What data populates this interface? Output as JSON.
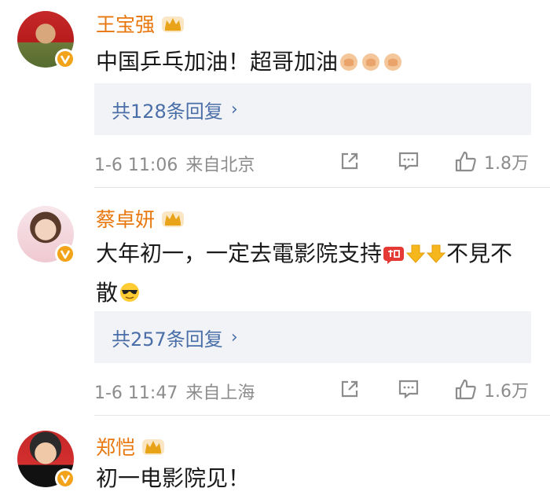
{
  "comments": [
    {
      "username": "王宝强",
      "text": "中国乒乓加油！超哥加油",
      "emojis_after": [
        "fist-emoji",
        "fist-emoji",
        "fist-emoji"
      ],
      "replies_label": "共128条回复",
      "date": "1-6 11:06",
      "location": "来自北京",
      "likes": "1.8万"
    },
    {
      "username": "蔡卓妍",
      "text_part1": "大年初一，一定去電影院支持",
      "text_part2": "不見不",
      "text_line2": "散",
      "emojis_mid": [
        "jiayou-sticker",
        "arrow-down-emoji",
        "arrow-down-emoji"
      ],
      "emojis_end": [
        "cool-face-emoji"
      ],
      "replies_label": "共257条回复",
      "date": "1-6 11:47",
      "location": "来自上海",
      "likes": "1.6万"
    },
    {
      "username": "郑恺",
      "text": "初一电影院见！"
    }
  ],
  "colors": {
    "username": "#e8770e",
    "link": "#4a6ea8",
    "meta": "#8c8c8c",
    "reply_bg": "#f2f3f6",
    "verified": "#f2a319"
  }
}
